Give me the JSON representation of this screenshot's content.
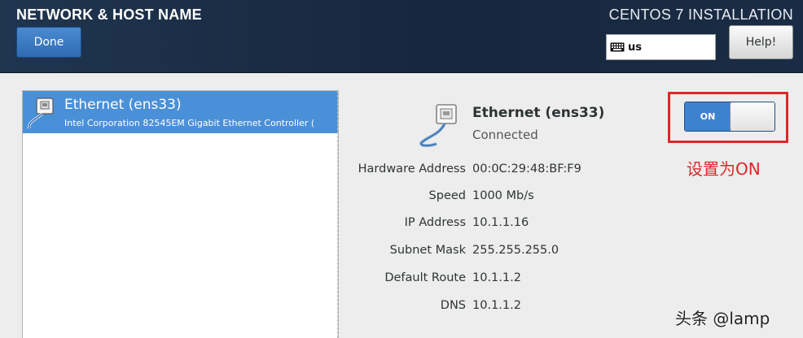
{
  "header": {
    "title": "NETWORK & HOST NAME",
    "done_label": "Done",
    "install_title": "CENTOS 7 INSTALLATION",
    "keyboard_layout": "us",
    "keyboard_icon": "keyboard-icon",
    "help_label": "Help!"
  },
  "device_list": {
    "items": [
      {
        "name": "Ethernet (ens33)",
        "description": "Intel Corporation 82545EM Gigabit Ethernet Controller (",
        "icon": "ethernet-icon",
        "selected": true
      }
    ]
  },
  "details": {
    "icon": "ethernet-icon",
    "name": "Ethernet (ens33)",
    "status": "Connected",
    "properties": [
      {
        "label": "Hardware Address",
        "value": "00:0C:29:48:BF:F9"
      },
      {
        "label": "Speed",
        "value": "1000 Mb/s"
      },
      {
        "label": "IP Address",
        "value": "10.1.1.16"
      },
      {
        "label": "Subnet Mask",
        "value": "255.255.255.0"
      },
      {
        "label": "Default Route",
        "value": "10.1.1.2"
      },
      {
        "label": "DNS",
        "value": "10.1.1.2"
      }
    ]
  },
  "connection_switch": {
    "label": "ON",
    "state": "on",
    "accent": "#3d82cf"
  },
  "annotation": {
    "text": "设置为ON",
    "color": "#e0262a"
  },
  "watermark": {
    "text": "头条 @lamp"
  }
}
